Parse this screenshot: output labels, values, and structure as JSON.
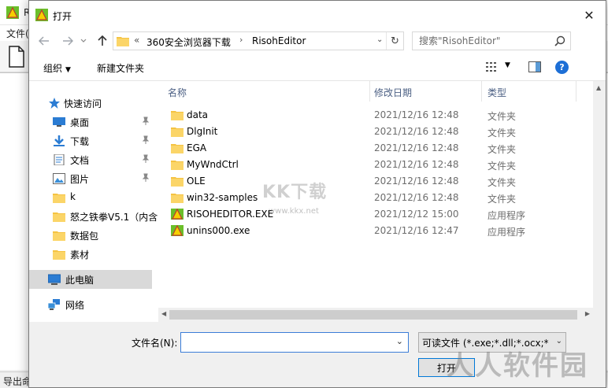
{
  "background": {
    "title_fragment": "R",
    "menu_fragment": "文件(",
    "status_fragment": "导出命"
  },
  "dialog": {
    "title": "打开",
    "close_glyph": "✕"
  },
  "address": {
    "chevron": "«",
    "segments": [
      "360安全浏览器下载",
      "RisohEditor"
    ],
    "separator": "›",
    "dropdown": "⌄",
    "refresh": "↻"
  },
  "search": {
    "placeholder": "搜索\"RisohEditor\""
  },
  "toolbar": {
    "organize_label": "组织",
    "organize_arrow": "▼",
    "new_folder_label": "新建文件夹",
    "view_arrow": "▼",
    "help_label": "?"
  },
  "nav_pane": {
    "items": [
      {
        "label": "快速访问",
        "icon": "star-icon",
        "pinned": false
      },
      {
        "label": "桌面",
        "icon": "desktop-icon",
        "pinned": true
      },
      {
        "label": "下载",
        "icon": "download-icon",
        "pinned": true
      },
      {
        "label": "文档",
        "icon": "document-icon",
        "pinned": true
      },
      {
        "label": "图片",
        "icon": "picture-icon",
        "pinned": true
      },
      {
        "label": "k",
        "icon": "folder-icon",
        "pinned": false
      },
      {
        "label": "怒之铁拳V5.1（内含",
        "icon": "folder-icon",
        "pinned": false
      },
      {
        "label": "数据包",
        "icon": "folder-icon",
        "pinned": false
      },
      {
        "label": "素材",
        "icon": "folder-icon",
        "pinned": false
      },
      {
        "label": "此电脑",
        "icon": "computer-icon",
        "pinned": false
      },
      {
        "label": "网络",
        "icon": "network-icon",
        "pinned": false
      }
    ],
    "selected": "此电脑"
  },
  "file_list": {
    "sort_indicator": "^",
    "columns": [
      "名称",
      "修改日期",
      "类型"
    ],
    "rows": [
      {
        "name": "data",
        "date": "2021/12/16 12:48",
        "type": "文件夹",
        "icon": "folder-icon"
      },
      {
        "name": "DlgInit",
        "date": "2021/12/16 12:48",
        "type": "文件夹",
        "icon": "folder-icon"
      },
      {
        "name": "EGA",
        "date": "2021/12/16 12:48",
        "type": "文件夹",
        "icon": "folder-icon"
      },
      {
        "name": "MyWndCtrl",
        "date": "2021/12/16 12:48",
        "type": "文件夹",
        "icon": "folder-icon"
      },
      {
        "name": "OLE",
        "date": "2021/12/16 12:48",
        "type": "文件夹",
        "icon": "folder-icon"
      },
      {
        "name": "win32-samples",
        "date": "2021/12/16 12:48",
        "type": "文件夹",
        "icon": "folder-icon"
      },
      {
        "name": "RISOHEDITOR.EXE",
        "date": "2021/12/12 15:00",
        "type": "应用程序",
        "icon": "exe-icon"
      },
      {
        "name": "unins000.exe",
        "date": "2021/12/16 12:47",
        "type": "应用程序",
        "icon": "exe-icon"
      }
    ]
  },
  "watermarks": {
    "kk": "KK下载",
    "kk_url": "www.kkx.net",
    "brand": "人人软件园"
  },
  "bottom": {
    "filename_label": "文件名(N):",
    "filename_value": "",
    "filename_dropdown": "⌄",
    "filter_value": "可读文件 (*.exe;*.dll;*.ocx;*.cp",
    "filter_dropdown": "⌄",
    "open_label": "打开"
  },
  "colors": {
    "folder": "#f5c342",
    "accent": "#0078d7",
    "help": "#1d6fd6"
  }
}
